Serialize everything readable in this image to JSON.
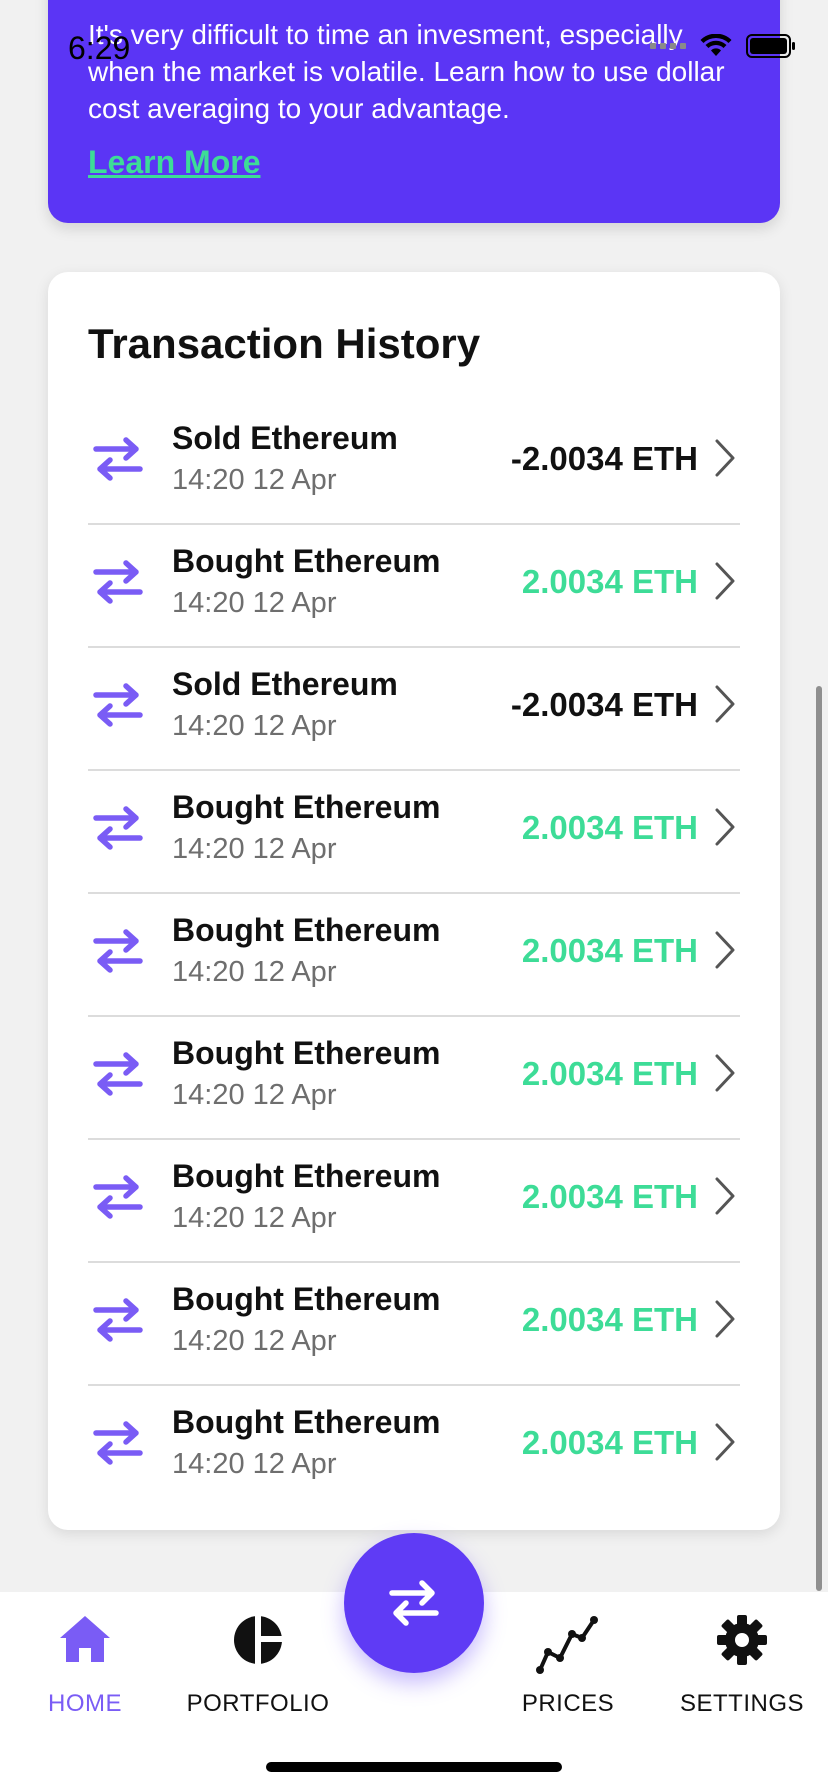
{
  "status_bar": {
    "time": "6:29",
    "wifi_icon": "wifi-icon",
    "battery_icon": "battery-icon"
  },
  "promo": {
    "text": "It's very difficult to time an invesment, especially when the market is volatile. Learn how to use dollar cost averaging to your advantage.",
    "link_label": "Learn More",
    "background_color": "#5b35f5",
    "link_color": "#3ddc97"
  },
  "transactions": {
    "title": "Transaction History",
    "icon": "swap-icon",
    "items": [
      {
        "name": "Sold Ethereum",
        "time": "14:20 12 Apr",
        "amount": "-2.0034 ETH",
        "type": "sold"
      },
      {
        "name": "Bought Ethereum",
        "time": "14:20 12 Apr",
        "amount": "2.0034 ETH",
        "type": "bought"
      },
      {
        "name": "Sold Ethereum",
        "time": "14:20 12 Apr",
        "amount": "-2.0034 ETH",
        "type": "sold"
      },
      {
        "name": "Bought Ethereum",
        "time": "14:20 12 Apr",
        "amount": "2.0034 ETH",
        "type": "bought"
      },
      {
        "name": "Bought Ethereum",
        "time": "14:20 12 Apr",
        "amount": "2.0034 ETH",
        "type": "bought"
      },
      {
        "name": "Bought Ethereum",
        "time": "14:20 12 Apr",
        "amount": "2.0034 ETH",
        "type": "bought"
      },
      {
        "name": "Bought Ethereum",
        "time": "14:20 12 Apr",
        "amount": "2.0034 ETH",
        "type": "bought"
      },
      {
        "name": "Bought Ethereum",
        "time": "14:20 12 Apr",
        "amount": "2.0034 ETH",
        "type": "bought"
      },
      {
        "name": "Bought Ethereum",
        "time": "14:20 12 Apr",
        "amount": "2.0034 ETH",
        "type": "bought"
      }
    ]
  },
  "colors": {
    "accent": "#7a5cf5",
    "positive": "#3ddc97",
    "negative": "#111111",
    "fab": "#5f3bf5"
  },
  "tab_bar": {
    "active": "home",
    "tabs": [
      {
        "id": "home",
        "label": "HOME",
        "icon": "home-icon"
      },
      {
        "id": "portfolio",
        "label": "PORTFOLIO",
        "icon": "pie-chart-icon"
      },
      {
        "id": "prices",
        "label": "PRICES",
        "icon": "line-chart-icon"
      },
      {
        "id": "settings",
        "label": "SETTINGS",
        "icon": "gear-icon"
      }
    ],
    "fab_icon": "swap-icon"
  }
}
